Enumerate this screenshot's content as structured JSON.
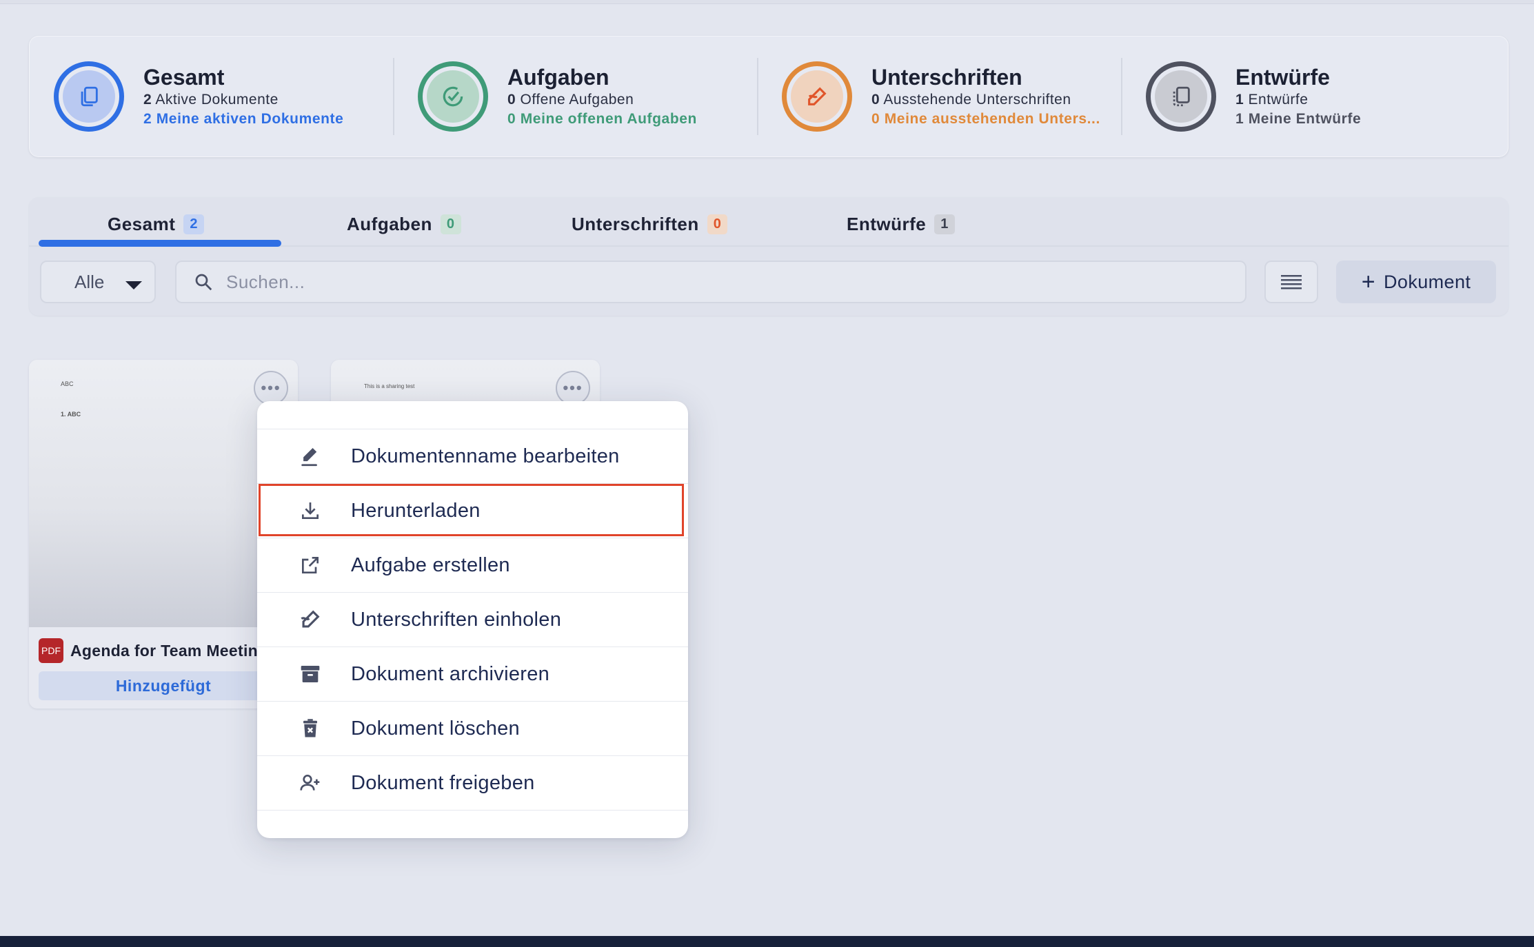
{
  "stats": [
    {
      "title": "Gesamt",
      "count": "2",
      "label": "Aktive Dokumente",
      "mine": "2 Meine aktiven Dokumente",
      "color": "#2f6fe4",
      "icon": "documents-icon"
    },
    {
      "title": "Aufgaben",
      "count": "0",
      "label": "Offene Aufgaben",
      "mine": "0 Meine offenen Aufgaben",
      "color": "#3f9b78",
      "icon": "check-circle-icon"
    },
    {
      "title": "Unterschriften",
      "count": "0",
      "label": "Ausstehende Unterschriften",
      "mine": "0 Meine ausstehenden Unters...",
      "color": "#e0893a",
      "icon": "signature-icon"
    },
    {
      "title": "Entwürfe",
      "count": "1",
      "label": "Entwürfe",
      "mine": "1 Meine Entwürfe",
      "color": "#4f5260",
      "icon": "draft-icon"
    }
  ],
  "tabs": [
    {
      "label": "Gesamt",
      "count": "2"
    },
    {
      "label": "Aufgaben",
      "count": "0"
    },
    {
      "label": "Unterschriften",
      "count": "0"
    },
    {
      "label": "Entwürfe",
      "count": "1"
    }
  ],
  "toolbar": {
    "filter_value": "Alle",
    "search_placeholder": "Suchen...",
    "add_label": "Dokument"
  },
  "cards": [
    {
      "thumb_line1": "ABC",
      "thumb_line2": "1. ABC",
      "type": "PDF",
      "name": "Agenda for Team Meeting",
      "status": "Hinzugefügt"
    },
    {
      "thumb_line1": "This is a sharing test"
    }
  ],
  "menu": {
    "items": [
      {
        "label": "Dokumentenname bearbeiten",
        "icon": "pen-icon"
      },
      {
        "label": "Herunterladen",
        "icon": "download-icon",
        "highlighted": true
      },
      {
        "label": "Aufgabe erstellen",
        "icon": "external-link-icon"
      },
      {
        "label": "Unterschriften einholen",
        "icon": "signature-icon"
      },
      {
        "label": "Dokument archivieren",
        "icon": "archive-icon"
      },
      {
        "label": "Dokument löschen",
        "icon": "trash-icon"
      },
      {
        "label": "Dokument freigeben",
        "icon": "user-plus-icon"
      }
    ]
  },
  "colors": {
    "accent": "#2f6fe4",
    "highlight_border": "#e0442a",
    "menu_text": "#1e2a52"
  }
}
